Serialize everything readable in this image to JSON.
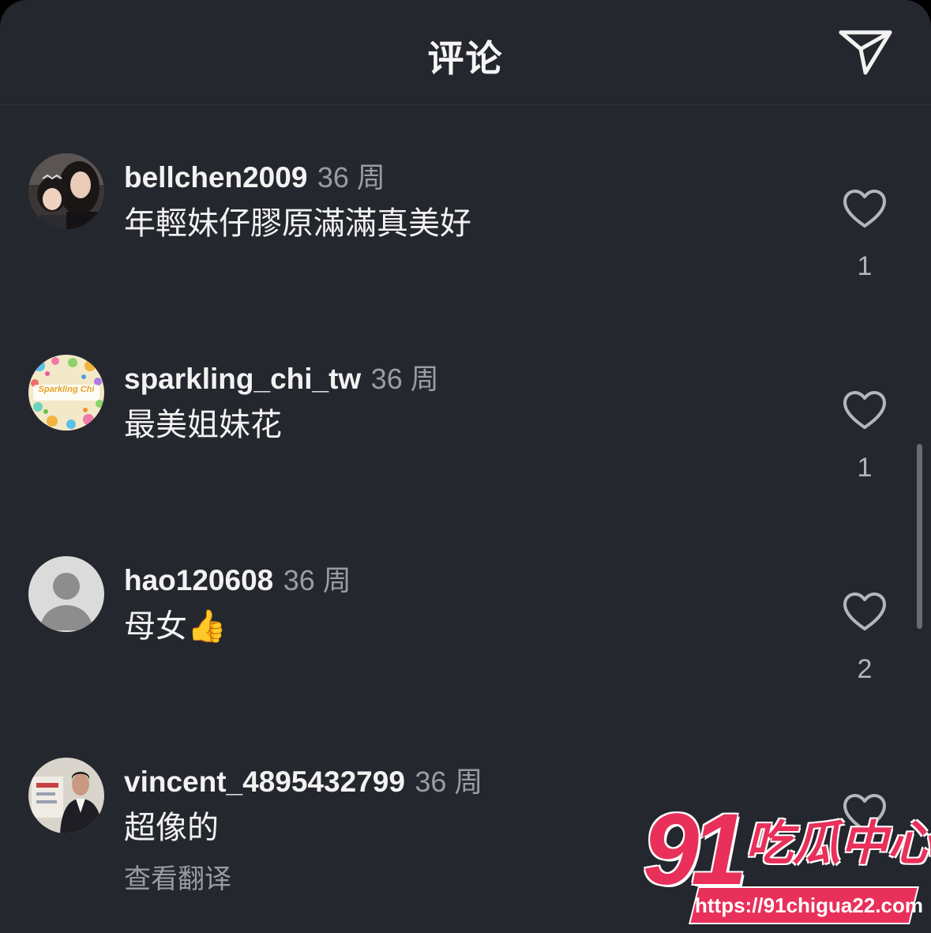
{
  "header": {
    "title": "评论",
    "share_icon": "paper-plane-icon"
  },
  "comments": [
    {
      "username": "bellchen2009",
      "time": "36 周",
      "text": "年輕妹仔膠原滿滿真美好",
      "likes": "1"
    },
    {
      "username": "sparkling_chi_tw",
      "time": "36 周",
      "text": "最美姐妹花",
      "likes": "1",
      "avatar_text": "Sparkling Chi"
    },
    {
      "username": "hao120608",
      "time": "36 周",
      "text": "母女👍",
      "likes": "2"
    },
    {
      "username": "vincent_4895432799",
      "time": "36 周",
      "text": "超像的",
      "likes": "",
      "translate": "查看翻译"
    }
  ],
  "watermark": {
    "number": "91",
    "text": "吃瓜中心",
    "url": "https://91chigua22.com"
  },
  "colors": {
    "background": "#25272e",
    "text_primary": "#f2f2f2",
    "text_secondary": "#9a9ca4",
    "watermark": "#e8305a"
  }
}
